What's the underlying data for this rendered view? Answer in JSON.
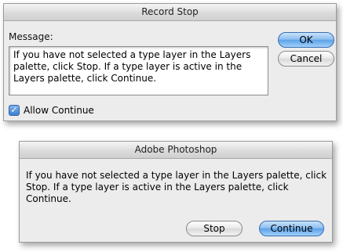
{
  "record_stop": {
    "title": "Record Stop",
    "message_label": "Message:",
    "message_text": "If you have not selected a type layer in the Layers palette, click Stop. If a type layer is active in the Layers palette, click Continue.",
    "allow_continue_label": "Allow Continue",
    "allow_continue_checked": true,
    "ok_label": "OK",
    "cancel_label": "Cancel"
  },
  "photoshop_alert": {
    "title": "Adobe Photoshop",
    "message": "If you have not selected a type layer in the Layers palette, click Stop. If a type layer is active in the Layers palette, click Continue.",
    "stop_label": "Stop",
    "continue_label": "Continue"
  },
  "colors": {
    "default_button": "#5ea2e8",
    "dialog_bg": "#ececec"
  }
}
